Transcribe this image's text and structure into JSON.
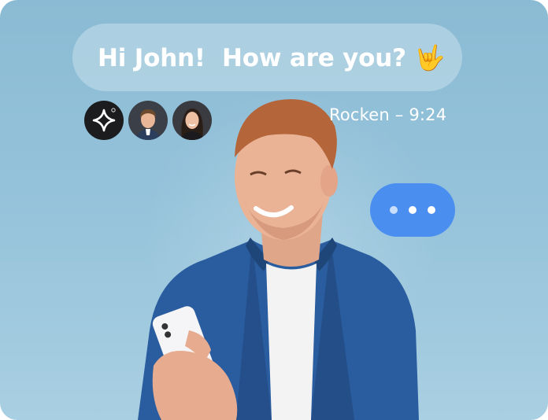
{
  "message": {
    "text": "Hi John!  How are you?",
    "emoji": "🤟"
  },
  "sender": {
    "name": "Rocken",
    "separator": " – ",
    "time": "9:24"
  },
  "avatars": [
    {
      "name": "sparkle-logo-avatar"
    },
    {
      "name": "male-avatar"
    },
    {
      "name": "female-avatar"
    }
  ],
  "typing_indicator": {
    "dot_count": 3
  },
  "colors": {
    "background": "#8bbbd4",
    "bubble": "#d2e6f0",
    "typing": "#4a8ff0",
    "logo": "#1c1c1e",
    "shirt": "#2a5d9f"
  }
}
